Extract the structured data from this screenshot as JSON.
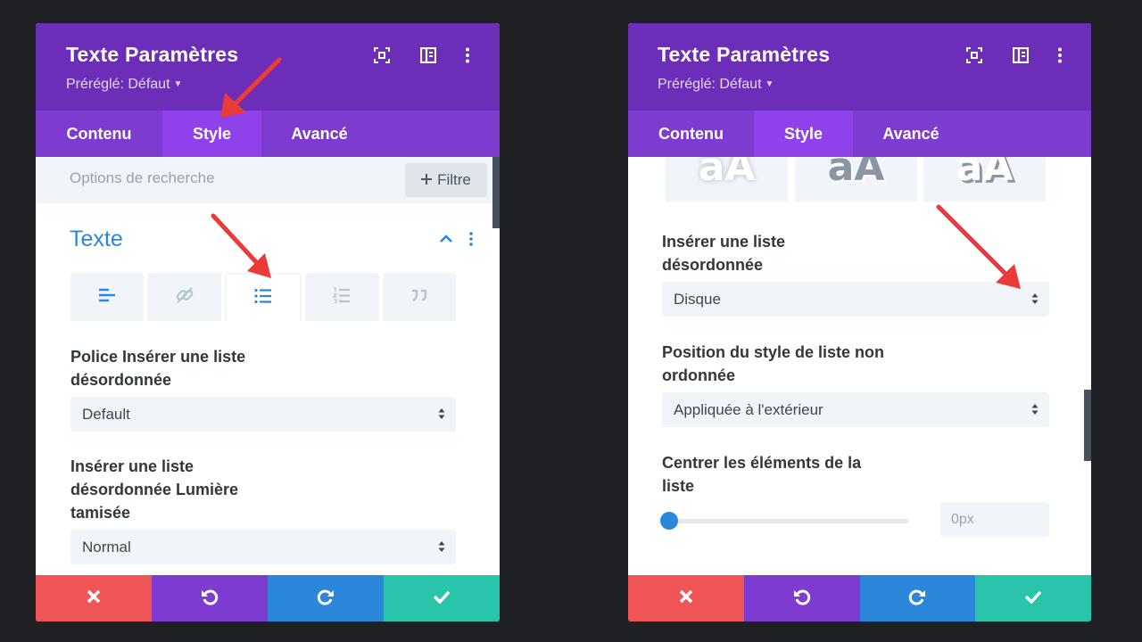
{
  "panels": [
    {
      "title": "Texte Paramètres",
      "preset": "Préréglé: Défaut",
      "tabs": [
        "Contenu",
        "Style",
        "Avancé"
      ],
      "active_tab": "Style",
      "search_placeholder": "Options de recherche",
      "filter_label": "Filtre",
      "section_title": "Texte",
      "fields": [
        {
          "label_lines": [
            "Police Insérer une liste",
            "désordonnée"
          ],
          "value": "Default"
        },
        {
          "label_lines": [
            "Insérer une liste",
            "désordonnée Lumière",
            "tamisée"
          ],
          "value": "Normal"
        }
      ]
    },
    {
      "title": "Texte Paramètres",
      "preset": "Préréglé: Défaut",
      "tabs": [
        "Contenu",
        "Style",
        "Avancé"
      ],
      "active_tab": "Style",
      "style_previews": [
        "aA",
        "aA",
        "aA"
      ],
      "fields": [
        {
          "label_lines": [
            "Insérer une liste",
            "désordonnée"
          ],
          "value": "Disque"
        },
        {
          "label_lines": [
            "Position du style de liste non",
            "ordonnée"
          ],
          "value": "Appliquée à l'extérieur"
        },
        {
          "label_lines": [
            "Centrer les éléments de la",
            "liste"
          ],
          "value": "0px"
        }
      ]
    }
  ],
  "colors": {
    "header": "#6c2eb9",
    "tabs": "#7e3bd0",
    "active_tab": "#8f42ec",
    "accent_blue": "#2b87da",
    "cancel": "#ef5555",
    "undo": "#7d3bd0",
    "redo": "#2b87da",
    "save": "#29c4a9",
    "annotation_arrow": "#ea3a3a"
  },
  "icons": {
    "header": [
      "fullscreen-icon",
      "split-view-icon",
      "more-vertical-icon"
    ],
    "subtabs": [
      "align-left-icon",
      "link-icon",
      "unordered-list-icon",
      "ordered-list-icon",
      "quote-icon"
    ],
    "footer": [
      "close-icon",
      "undo-icon",
      "redo-icon",
      "check-icon"
    ]
  }
}
